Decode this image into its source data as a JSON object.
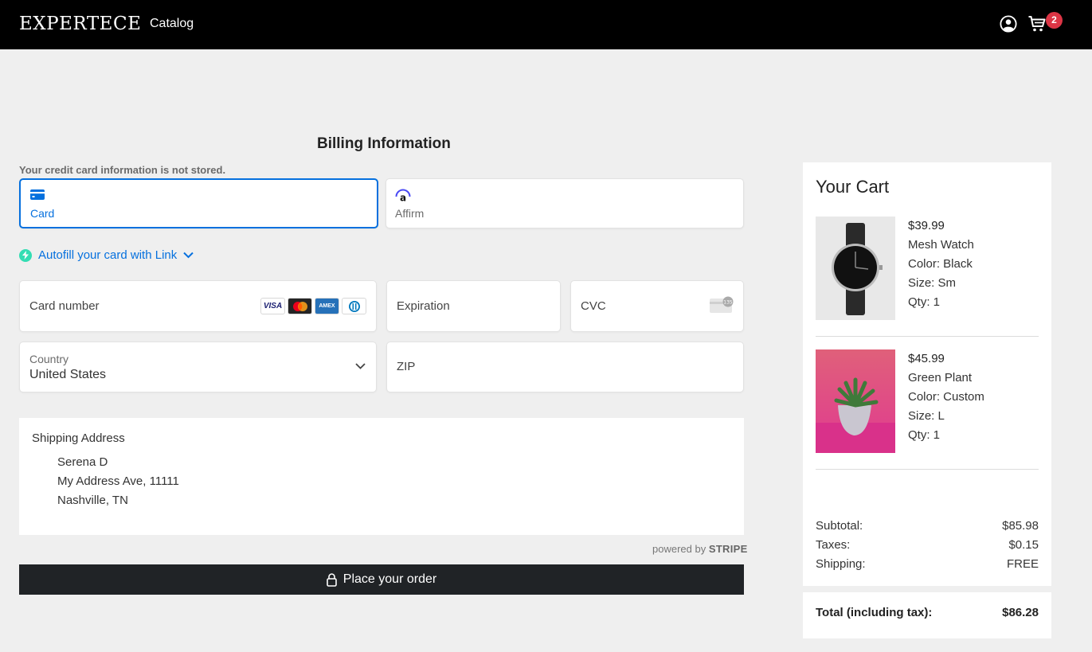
{
  "header": {
    "brand": "EXPERTECE",
    "nav_catalog": "Catalog",
    "cart_count": "2"
  },
  "billing": {
    "title": "Billing Information",
    "notice": "Your credit card information is not stored.",
    "payment_methods": [
      {
        "label": "Card",
        "selected": true
      },
      {
        "label": "Affirm",
        "selected": false
      }
    ],
    "autofill_link": "Autofill your card with Link",
    "card_number_placeholder": "Card number",
    "card_brands": [
      "VISA",
      "mastercard",
      "AMEX",
      "diners"
    ],
    "expiration_placeholder": "Expiration",
    "cvc_placeholder": "CVC",
    "cvc_hint": "135",
    "country_label": "Country",
    "country_value": "United States",
    "zip_placeholder": "ZIP"
  },
  "shipping": {
    "title": "Shipping Address",
    "name": "Serena D",
    "street": "My Address Ave, 11111",
    "city": "Nashville, TN"
  },
  "powered_by": {
    "prefix": "powered by",
    "brand": "STRIPE"
  },
  "place_order_label": "Place your order",
  "cart": {
    "title": "Your Cart",
    "items": [
      {
        "price": "$39.99",
        "name": "Mesh Watch",
        "color": "Color: Black",
        "size": "Size: Sm",
        "qty": "Qty: 1"
      },
      {
        "price": "$45.99",
        "name": "Green Plant",
        "color": "Color: Custom",
        "size": "Size: L",
        "qty": "Qty: 1"
      }
    ],
    "subtotal_label": "Subtotal:",
    "subtotal_value": "$85.98",
    "taxes_label": "Taxes:",
    "taxes_value": "$0.15",
    "shipping_label": "Shipping:",
    "shipping_value": "FREE",
    "total_label": "Total (including tax):",
    "total_value": "$86.28"
  },
  "colors": {
    "accent": "#0570de",
    "badge": "#dc3545",
    "button": "#202326"
  }
}
